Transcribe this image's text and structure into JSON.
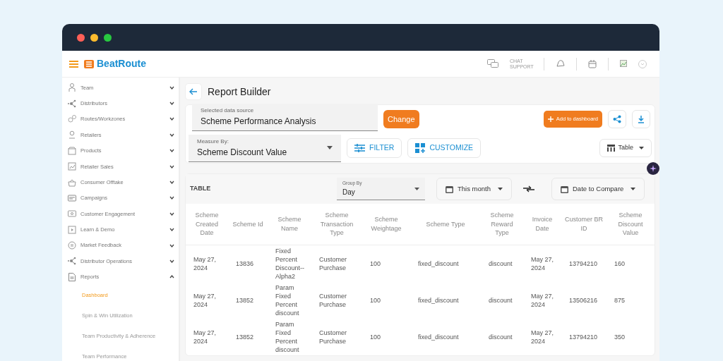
{
  "app_header": {
    "logo_text": "BeatRoute",
    "chat_support": "CHAT SUPPORT"
  },
  "sidebar": {
    "items": [
      {
        "label": "Team",
        "expanded": false
      },
      {
        "label": "Distributors",
        "expanded": false
      },
      {
        "label": "Routes/Workzones",
        "expanded": false
      },
      {
        "label": "Retailers",
        "expanded": false
      },
      {
        "label": "Products",
        "expanded": false
      },
      {
        "label": "Retailer Sales",
        "expanded": false
      },
      {
        "label": "Consumer Offtake",
        "expanded": false
      },
      {
        "label": "Campaigns",
        "expanded": false
      },
      {
        "label": "Customer Engagement",
        "expanded": false
      },
      {
        "label": "Learn & Demo",
        "expanded": false
      },
      {
        "label": "Market Feedback",
        "expanded": false
      },
      {
        "label": "Distributor Operations",
        "expanded": false
      },
      {
        "label": "Reports",
        "expanded": true,
        "children": [
          {
            "label": "Dashboard",
            "selected": true
          },
          {
            "label": "Spin & Win Utilization",
            "selected": false
          },
          {
            "label": "Team Productivity & Adherence",
            "selected": false
          },
          {
            "label": "Team Performance",
            "selected": false
          }
        ]
      }
    ]
  },
  "page": {
    "title": "Report Builder"
  },
  "data_source": {
    "label": "Selected data source",
    "value": "Scheme Performance Analysis",
    "change_button": "Change",
    "add_button": "Add to dashboard"
  },
  "measure": {
    "label": "Measure By:",
    "value": "Scheme Discount Value"
  },
  "filter_button": "FILTER",
  "customize_button": "CUSTOMIZE",
  "view_dropdown": "Table",
  "table_section": {
    "title": "TABLE",
    "group_by": {
      "label": "Group By",
      "value": "Day"
    },
    "period_button": "This month",
    "compare_button": "Date to Compare"
  },
  "table": {
    "columns": [
      "Scheme Created Date",
      "Scheme Id",
      "Scheme Name",
      "Scheme Transaction Type",
      "Scheme Weightage",
      "Scheme Type",
      "Scheme Reward Type",
      "Invoice Date",
      "Customer BR ID",
      "Scheme Discount Value"
    ],
    "rows": [
      [
        "May 27, 2024",
        "13836",
        "Fixed Percent Discount--Alpha2",
        "Customer Purchase",
        "100",
        "fixed_discount",
        "discount",
        "May 27, 2024",
        "13794210",
        "160"
      ],
      [
        "May 27, 2024",
        "13852",
        "Param Fixed Percent discount",
        "Customer Purchase",
        "100",
        "fixed_discount",
        "discount",
        "May 27, 2024",
        "13506216",
        "875"
      ],
      [
        "May 27, 2024",
        "13852",
        "Param Fixed Percent discount",
        "Customer Purchase",
        "100",
        "fixed_discount",
        "discount",
        "May 27, 2024",
        "13794210",
        "350"
      ]
    ]
  }
}
